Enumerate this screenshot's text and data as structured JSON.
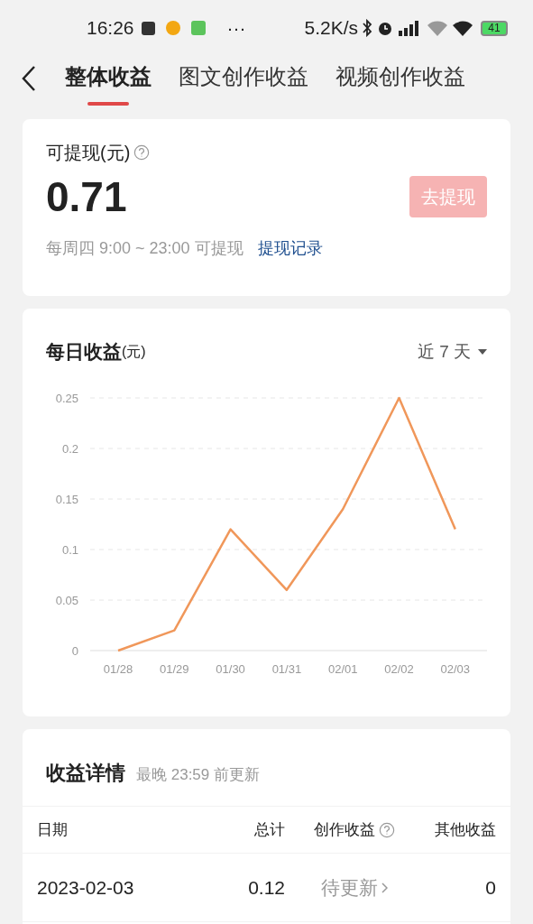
{
  "status_bar": {
    "time": "16:26",
    "more": "···",
    "speed": "5.2K/s",
    "battery": "41"
  },
  "tabs": [
    {
      "label": "整体收益",
      "selected": true
    },
    {
      "label": "图文创作收益",
      "selected": false
    },
    {
      "label": "视频创作收益",
      "selected": false
    }
  ],
  "balance": {
    "label": "可提现(元)",
    "amount": "0.71",
    "button": "去提现",
    "schedule": "每周四 9:00 ~ 23:00 可提现",
    "link": "提现记录"
  },
  "daily": {
    "title": "每日收益",
    "unit": "(元)",
    "range": "近 7 天",
    "chart_data": {
      "type": "line",
      "categories": [
        "01/28",
        "01/29",
        "01/30",
        "01/31",
        "02/01",
        "02/02",
        "02/03"
      ],
      "grid": true,
      "series": [
        {
          "color": "#f0975a",
          "values": [
            0,
            0.02,
            0.12,
            0.06,
            0.14,
            0.25,
            0.12
          ]
        }
      ],
      "ylim": [
        0,
        0.25
      ],
      "yticks": [
        {
          "value": 0,
          "label": "0"
        },
        {
          "value": 0.05,
          "label": "0.05"
        },
        {
          "value": 0.1,
          "label": "0.1"
        },
        {
          "value": 0.15,
          "label": "0.15"
        },
        {
          "value": 0.2,
          "label": "0.2"
        },
        {
          "value": 0.25,
          "label": "0.25"
        }
      ]
    }
  },
  "details": {
    "title": "收益详情",
    "note": "最晚 23:59 前更新",
    "columns": [
      "日期",
      "总计",
      "创作收益",
      "其他收益"
    ],
    "rows": [
      {
        "date": "2023-02-03",
        "total": "0.12",
        "creation": "待更新",
        "other": "0"
      }
    ]
  }
}
